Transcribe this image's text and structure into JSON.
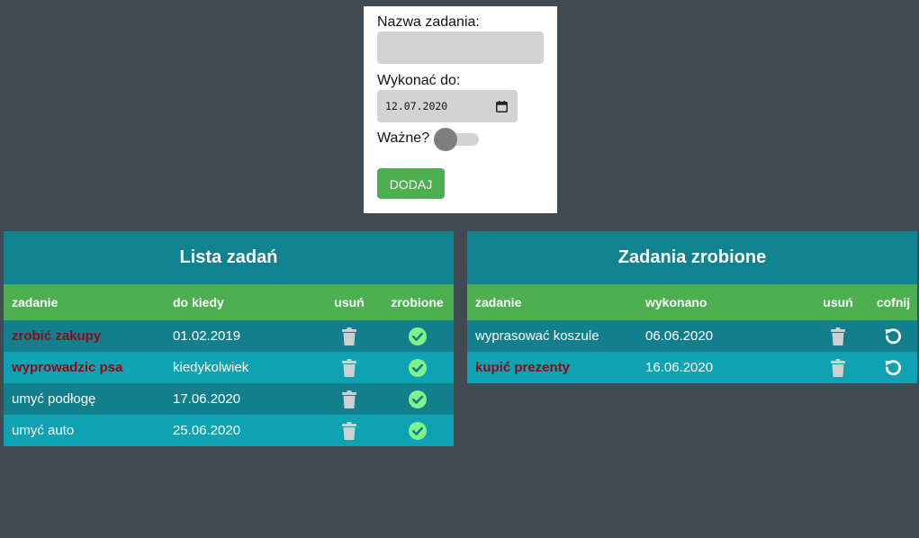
{
  "form": {
    "task_name_label": "Nazwa zadania:",
    "task_name_value": "",
    "due_label": "Wykonać do:",
    "due_value": "12.07.2020",
    "important_label": "Ważne?",
    "important_checked": false,
    "add_button": "Dodaj"
  },
  "todo": {
    "title": "Lista zadań",
    "headers": {
      "task": "zadanie",
      "date": "do kiedy",
      "delete": "usuń",
      "done": "zrobione"
    },
    "rows": [
      {
        "task": "zrobić zakupy",
        "date": "01.02.2019",
        "important": true
      },
      {
        "task": "wyprowadzic psa",
        "date": "kiedykolwiek",
        "important": true
      },
      {
        "task": "umyć podłogę",
        "date": "17.06.2020",
        "important": false
      },
      {
        "task": "umyć auto",
        "date": "25.06.2020",
        "important": false
      }
    ]
  },
  "done": {
    "title": "Zadania zrobione",
    "headers": {
      "task": "zadanie",
      "date": "wykonano",
      "delete": "usuń",
      "undo": "cofnij"
    },
    "rows": [
      {
        "task": "wyprasować koszule",
        "date": "06.06.2020",
        "important": false
      },
      {
        "task": "kupić prezenty",
        "date": "16.06.2020",
        "important": true
      }
    ]
  },
  "colors": {
    "page_bg": "#3f4a52",
    "header_bg": "#118290",
    "column_header_bg": "#4caf50",
    "row_dark": "#127f8c",
    "row_light": "#0fa2b3",
    "important_text": "#8b0d12",
    "check_icon": "#7ff28a",
    "trash_icon": "#cfcfcf"
  },
  "icons": {
    "delete": "trash-icon",
    "done": "check-circle-icon",
    "undo": "undo-icon",
    "date_picker": "calendar-icon"
  }
}
